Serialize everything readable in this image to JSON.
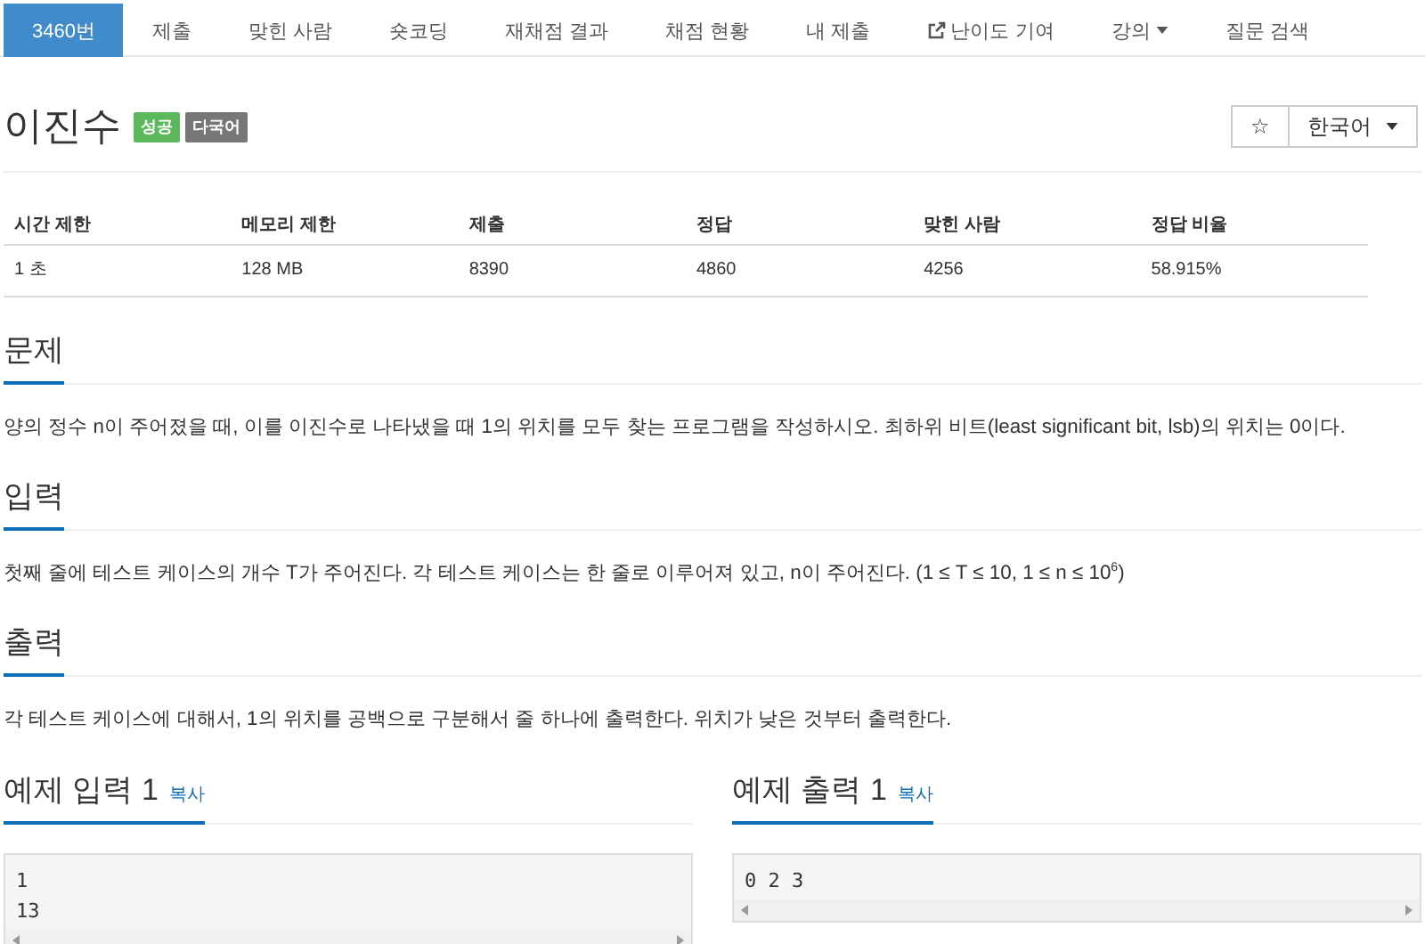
{
  "nav_tabs": [
    {
      "label": "3460번",
      "selected": true,
      "kind": "plain"
    },
    {
      "label": "제출",
      "selected": false,
      "kind": "plain"
    },
    {
      "label": "맞힌 사람",
      "selected": false,
      "kind": "plain"
    },
    {
      "label": "숏코딩",
      "selected": false,
      "kind": "plain"
    },
    {
      "label": "재채점 결과",
      "selected": false,
      "kind": "plain"
    },
    {
      "label": "채점 현황",
      "selected": false,
      "kind": "plain"
    },
    {
      "label": "내 제출",
      "selected": false,
      "kind": "plain"
    },
    {
      "label": "난이도 기여",
      "selected": false,
      "kind": "external"
    },
    {
      "label": "강의",
      "selected": false,
      "kind": "dropdown"
    },
    {
      "label": "질문 검색",
      "selected": false,
      "kind": "plain"
    }
  ],
  "problem": {
    "title": "이진수",
    "badges": [
      {
        "label": "성공",
        "color": "#5cb85c"
      },
      {
        "label": "다국어",
        "color": "#777777"
      }
    ],
    "star": "☆",
    "language": "한국어"
  },
  "info_table": {
    "columns": [
      "시간 제한",
      "메모리 제한",
      "제출",
      "정답",
      "맞힌 사람",
      "정답 비율"
    ],
    "rows": [
      [
        "1 초",
        "128 MB",
        "8390",
        "4860",
        "4256",
        "58.915%"
      ]
    ]
  },
  "sections": [
    {
      "heading": "문제",
      "body": "양의 정수 n이 주어졌을 때, 이를 이진수로 나타냈을 때 1의 위치를 모두 찾는 프로그램을 작성하시오. 최하위 비트(least significant bit, lsb)의 위치는 0이다."
    },
    {
      "heading": "입력",
      "body": "첫째 줄에 테스트 케이스의 개수 T가 주어진다. 각 테스트 케이스는 한 줄로 이루어져 있고, n이 주어진다. (1 ≤ T ≤ 10, 1 ≤ n ≤ 10$^{6}$)"
    },
    {
      "heading": "출력",
      "body": "각 테스트 케이스에 대해서, 1의 위치를 공백으로 구분해서 줄 하나에 출력한다. 위치가 낮은 것부터 출력한다."
    }
  ],
  "samples": [
    {
      "heading": "예제 입력 1",
      "copy": "복사",
      "lines": [
        "1",
        "13"
      ]
    },
    {
      "heading": "예제 출력 1",
      "copy": "복사",
      "lines": [
        "0 2 3"
      ]
    }
  ]
}
